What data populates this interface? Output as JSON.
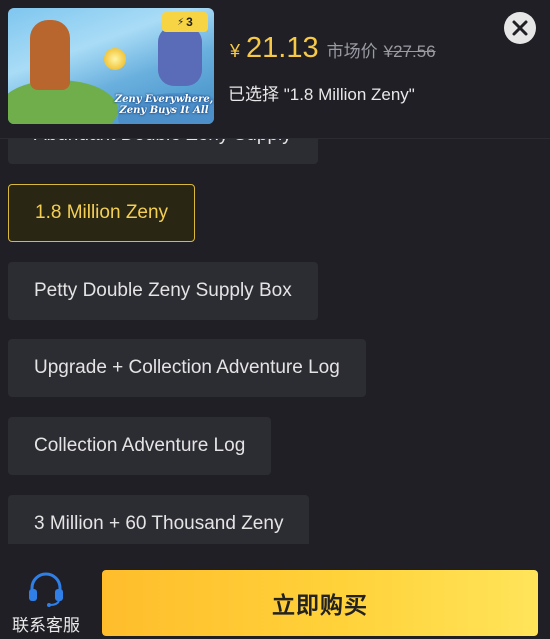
{
  "product": {
    "badge_text": "3",
    "image_caption_line1": "Zeny Everywhere,",
    "image_caption_line2": "Zeny Buys It All"
  },
  "price": {
    "currency": "¥",
    "current": "21.13",
    "market_label": "市场价",
    "market_currency": "¥",
    "market_value": "27.56"
  },
  "selection_text": "已选择 \"1.8 Million Zeny\"",
  "options": [
    {
      "label": "Abundant Double Zeny Supply",
      "selected": false
    },
    {
      "label": "1.8 Million Zeny",
      "selected": true
    },
    {
      "label": "Petty Double Zeny Supply Box",
      "selected": false
    },
    {
      "label": "Upgrade + Collection Adventure Log",
      "selected": false
    },
    {
      "label": "Collection Adventure Log",
      "selected": false
    },
    {
      "label": "3 Million + 60 Thousand Zeny",
      "selected": false
    }
  ],
  "footer": {
    "customer_service_label": "联系客服",
    "buy_label": "立即购买"
  },
  "colors": {
    "accent": "#f7c945",
    "background": "#1f1f25",
    "option_bg": "#2c2c33",
    "buy_button": "#ffd23a"
  },
  "icons": {
    "close": "close-icon",
    "customer_service": "headset-icon"
  }
}
